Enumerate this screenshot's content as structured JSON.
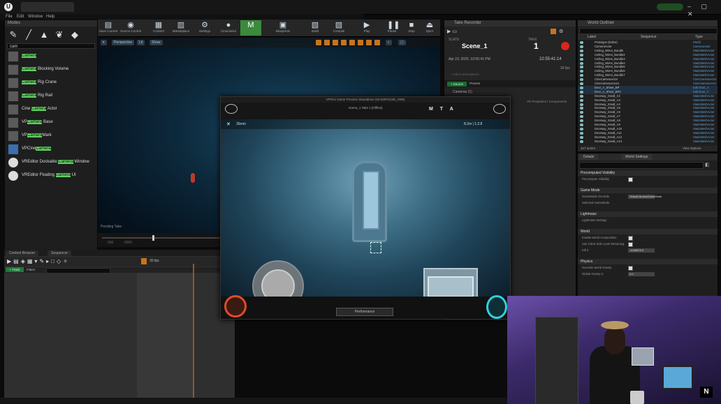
{
  "window": {
    "logo": "U",
    "doc_tab": "",
    "user": "",
    "controls": "– ▢ ✕"
  },
  "menu": [
    "File",
    "Edit",
    "Window",
    "Help"
  ],
  "modes": {
    "header": "Modes",
    "search_value": "cam",
    "items": [
      {
        "label": "Camera"
      },
      {
        "label": "Camera Blocking Volume"
      },
      {
        "label": "Camera Rig Crane"
      },
      {
        "label": "Camera Rig Rail"
      },
      {
        "label": "Cine Camera Actor"
      },
      {
        "label": "VPCamera Base"
      },
      {
        "label": "VPCameraMark"
      },
      {
        "label": "VPCineCamera"
      },
      {
        "label": "VREditor Dockable Camera Window"
      },
      {
        "label": "VREditor Floating Camera UI"
      }
    ]
  },
  "toolbar": {
    "buttons": [
      {
        "label": "Save Current",
        "icon": "save-icon"
      },
      {
        "label": "Source Control",
        "icon": "source-control-icon"
      },
      {
        "label": "Content",
        "icon": "content-icon"
      },
      {
        "label": "Marketplace",
        "icon": "marketplace-icon"
      },
      {
        "label": "Settings",
        "icon": "settings-icon"
      },
      {
        "label": "Cinematics",
        "icon": "cinematics-icon"
      },
      {
        "label": "Blueprints",
        "icon": "blueprints-icon"
      },
      {
        "label": "Build",
        "icon": "build-icon"
      },
      {
        "label": "Compile",
        "icon": "compile-icon"
      },
      {
        "label": "Play",
        "icon": "play-icon"
      },
      {
        "label": "Pause",
        "icon": "pause-icon"
      },
      {
        "label": "Stop",
        "icon": "stop-icon"
      },
      {
        "label": "Eject",
        "icon": "eject-icon"
      }
    ]
  },
  "viewport": {
    "perspective": "Perspective",
    "lit": "Lit",
    "show": "Show",
    "pending_label": "Pending Take",
    "timeline_start": "000",
    "timeline_end": "0000"
  },
  "take_recorder": {
    "header": "Take Recorder",
    "slate_label": "SLATE",
    "take_label": "TAKE",
    "scene": "Scene_1",
    "take": "1",
    "date": "Apr 23, 2020, 10:55:41 PM",
    "timecode": "22:55:41:14",
    "fps": "30 fps",
    "description_placeholder": "<Add a description>",
    "source_button": "+ Source",
    "presets": "Presets",
    "cameras_section": "Cameras (1)",
    "props_hint": "VR Properties / Components"
  },
  "outliner": {
    "header": "World Outliner",
    "col_label": "Label",
    "col_sequence": "Sequence",
    "col_type": "Type",
    "rows": [
      {
        "name": "Prototype (Editor)",
        "type": "World"
      },
      {
        "name": "CameraActor",
        "type": "CameraActor"
      },
      {
        "name": "Ceiling_Wires_Bundle",
        "type": "StaticMeshActor"
      },
      {
        "name": "Ceiling_Wires_Bundle2",
        "type": "StaticMeshActor"
      },
      {
        "name": "Ceiling_Wires_Bundle3",
        "type": "StaticMeshActor"
      },
      {
        "name": "Ceiling_Wires_Bundle4",
        "type": "StaticMeshActor"
      },
      {
        "name": "Ceiling_Wires_Bundle5",
        "type": "StaticMeshActor"
      },
      {
        "name": "Ceiling_Wires_Bundle6",
        "type": "StaticMeshActor"
      },
      {
        "name": "Ceiling_Wires_Bundle7",
        "type": "StaticMeshActor"
      },
      {
        "name": "CineCameraActor",
        "type": "CineCameraActor"
      },
      {
        "name": "CineCameraActor1",
        "type": "CineCameraActor"
      },
      {
        "name": "Door_A_Sheet_BP",
        "type": "Edit Door_A"
      },
      {
        "name": "Door_A_Sheet_BP2",
        "type": "Edit Door_A"
      },
      {
        "name": "Doorway_Small_A2",
        "type": "StaticMeshActor"
      },
      {
        "name": "Doorway_Small_A3",
        "type": "StaticMeshActor"
      },
      {
        "name": "Doorway_Small_A4",
        "type": "StaticMeshActor"
      },
      {
        "name": "Doorway_Small_A5",
        "type": "StaticMeshActor"
      },
      {
        "name": "Doorway_Small_A6",
        "type": "StaticMeshActor"
      },
      {
        "name": "Doorway_Small_A7",
        "type": "StaticMeshActor"
      },
      {
        "name": "Doorway_Small_A8",
        "type": "StaticMeshActor"
      },
      {
        "name": "Doorway_Small_A9",
        "type": "StaticMeshActor"
      },
      {
        "name": "Doorway_Small_A10",
        "type": "StaticMeshActor"
      },
      {
        "name": "Doorway_Small_A11",
        "type": "StaticMeshActor"
      },
      {
        "name": "Doorway_Small_A12",
        "type": "StaticMeshActor"
      },
      {
        "name": "Doorway_Small_A13",
        "type": "StaticMeshActor"
      }
    ],
    "footer_count": "427 actors",
    "view_options": "View Options"
  },
  "details": {
    "tab_details": "Details",
    "tab_world": "World Settings",
    "sections": [
      {
        "title": "Precomputed Visibility",
        "rows": [
          {
            "label": "Precompute Visibility",
            "kind": "check"
          }
        ]
      },
      {
        "title": "Game Mode",
        "rows": [
          {
            "label": "GameMode Override",
            "kind": "field",
            "value": "VirtualCameraGameMode"
          },
          {
            "label": "Selected GameMode",
            "kind": "none"
          }
        ]
      },
      {
        "title": "Lightmass",
        "rows": [
          {
            "label": "Lightmass Settings",
            "kind": "none"
          }
        ]
      },
      {
        "title": "World",
        "rows": [
          {
            "label": "Enable World Composition",
            "kind": "check"
          },
          {
            "label": "Use Client Side Level Streaming",
            "kind": "check"
          },
          {
            "label": "Kill Z",
            "kind": "field",
            "value": "-1048575.0"
          }
        ]
      },
      {
        "title": "Physics",
        "rows": [
          {
            "label": "Override World Gravity",
            "kind": "check"
          },
          {
            "label": "Global Gravity Z",
            "kind": "field",
            "value": "0.0"
          }
        ]
      }
    ]
  },
  "content_browser": {
    "tab_content": "Content Browser",
    "tab_sequencer": "Sequencer",
    "add_new": "+ Track",
    "filters": "Filters",
    "fps": "30 fps"
  },
  "popup": {
    "title": "VPFlex Game Preview Standalone (64-bit/PCD3D_SM5)",
    "menu_label": "Scene_1    Take 1    [Offline]",
    "mta": "M T A",
    "focal": "35mm",
    "aspect": "8.2m  |  1:2.8",
    "perf_button": "Performance"
  },
  "webcam": {
    "logo": "N"
  },
  "colors": {
    "accent_orange": "#c8731c",
    "record_red": "#d9271c",
    "source_green": "#1a6b2e",
    "link_blue": "#5fa0d8",
    "highlight_green": "#5fd15f"
  }
}
